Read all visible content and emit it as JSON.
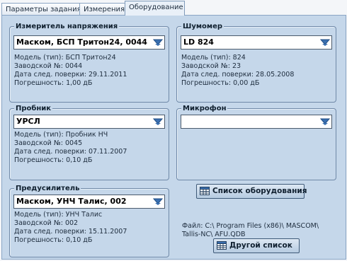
{
  "tabs": [
    {
      "label": "Параметры задания"
    },
    {
      "label": "Измерения"
    },
    {
      "label": "Оборудование"
    }
  ],
  "voltmeter": {
    "title": "Измеритель напряжения",
    "selected": "Маском, БСП Тритон24, 0044",
    "model": "Модель (тип): БСП Тритон24",
    "serial": "Заводской №: 0044",
    "verification": "Дата след. поверки: 29.11.2011",
    "error": "Погрешность: 1,00 дБ"
  },
  "noisemeter": {
    "title": "Шумомер",
    "selected": "LD 824",
    "model": "Модель (тип): 824",
    "serial": "Заводской №: 23",
    "verification": "Дата след. поверки: 28.05.2008",
    "error": "Погрешность: 0,00 дБ"
  },
  "probe": {
    "title": "Пробник",
    "selected": "УРСЛ",
    "model": "Модель (тип): Пробник НЧ",
    "serial": "Заводской №: 0045",
    "verification": "Дата след. поверки: 07.11.2007",
    "error": "Погрешность: 0,10 дБ"
  },
  "microphone": {
    "title": "Микрофон",
    "selected": ""
  },
  "preamp": {
    "title": "Предусилитель",
    "selected": "Маском, УНЧ Талис, 002",
    "model": "Модель (тип): УНЧ Талис",
    "serial": "Заводской №: 002",
    "verification": "Дата след. поверки: 15.11.2007",
    "error": "Погрешность: 0,10 дБ"
  },
  "equipment_list_button": "Список оборудования",
  "file_path": "Файл: C:\\ Program Files (x86)\\ MASCOM\\ Tallis-NC\\ AFU.QDB",
  "other_list_button": "Другой список",
  "icons": {
    "dropdown": "dropdown-arrow-icon",
    "list": "table-list-icon"
  }
}
